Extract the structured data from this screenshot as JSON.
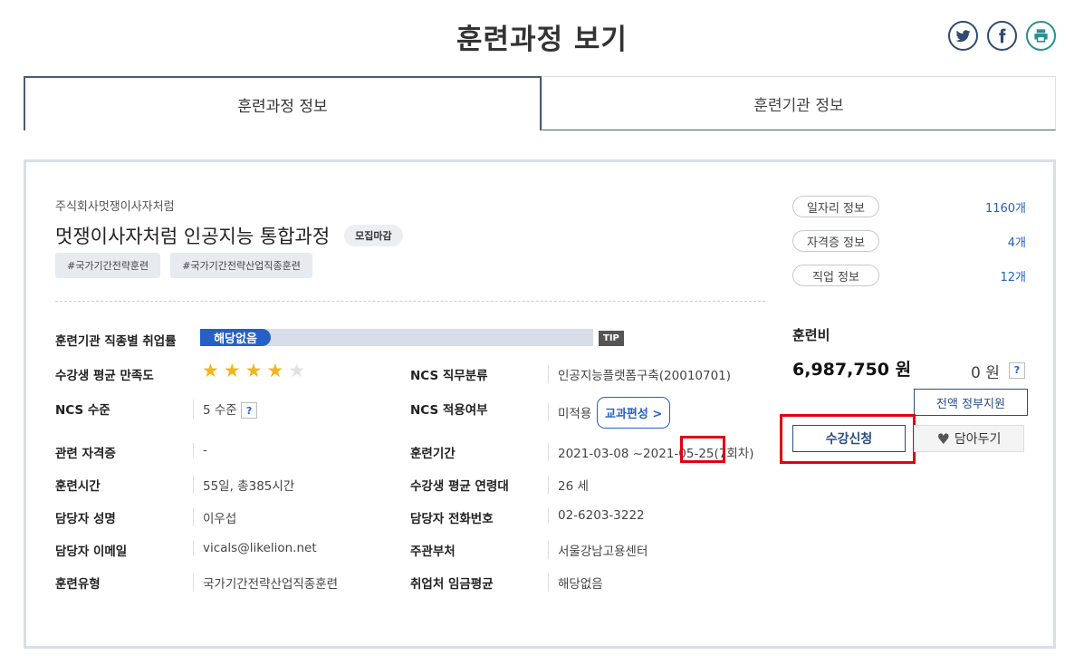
{
  "page": {
    "title": "훈련과정 보기"
  },
  "share": [
    {
      "name": "twitter-icon"
    },
    {
      "name": "facebook-icon"
    },
    {
      "name": "print-icon"
    }
  ],
  "tabs": [
    {
      "label": "훈련과정 정보",
      "active": true
    },
    {
      "label": "훈련기관 정보",
      "active": false
    }
  ],
  "course": {
    "organization": "주식회사멋쟁이사자처럼",
    "title": "멋쟁이사자처럼 인공지능 통합과정",
    "status_badge": "모집마감",
    "tags": [
      "#국가기간전략훈련",
      "#국가기간전략산업직종훈련"
    ]
  },
  "details": {
    "employment_rate": {
      "label": "훈련기관 직종별 취업률",
      "value": "해당없음",
      "tip": "TIP"
    },
    "satisfaction": {
      "label": "수강생 평균 만족도",
      "stars_filled": 4,
      "stars_total": 5
    },
    "ncs_category": {
      "label": "NCS 직무분류",
      "value": "인공지능플랫폼구축(20010701)"
    },
    "ncs_level": {
      "label": "NCS 수준",
      "value": "5 수준",
      "help": "?"
    },
    "ncs_applied": {
      "label": "NCS 적용여부",
      "value": "미적용",
      "button": "교과편성 >"
    },
    "certificate": {
      "label": "관련 자격증",
      "value": "-"
    },
    "period": {
      "label": "훈련기간",
      "value": "2021-03-08 ~2021-05-25",
      "round": "(7회차)"
    },
    "hours": {
      "label": "훈련시간",
      "value": "55일, 총385시간"
    },
    "avg_age": {
      "label": "수강생 평균 연령대",
      "value": "26 세"
    },
    "manager_name": {
      "label": "담당자 성명",
      "value": "이우섭"
    },
    "manager_phone": {
      "label": "담당자 전화번호",
      "value": "02-6203-3222"
    },
    "manager_email": {
      "label": "담당자 이메일",
      "value": "vicals@likelion.net"
    },
    "department": {
      "label": "주관부처",
      "value": "서울강남고용센터"
    },
    "training_type": {
      "label": "훈련유형",
      "value": "국가기간전략산업직종훈련"
    },
    "avg_wage": {
      "label": "취업처 임금평균",
      "value": "해당없음"
    }
  },
  "sidebar": {
    "links": [
      {
        "label": "일자리 정보",
        "count": "1160개"
      },
      {
        "label": "자격증 정보",
        "count": "4개"
      },
      {
        "label": "직업 정보",
        "count": "12개"
      }
    ],
    "fee_label": "훈련비",
    "fee_amount": "6,987,750 원",
    "self_pay": "0 원",
    "help": "?",
    "gov_support_button": "전액 정부지원",
    "apply_button": "수강신청",
    "save_button": "담아두기"
  },
  "colors": {
    "accent": "#2460c6",
    "navy": "#2a4d86",
    "highlight": "#e1000f"
  }
}
